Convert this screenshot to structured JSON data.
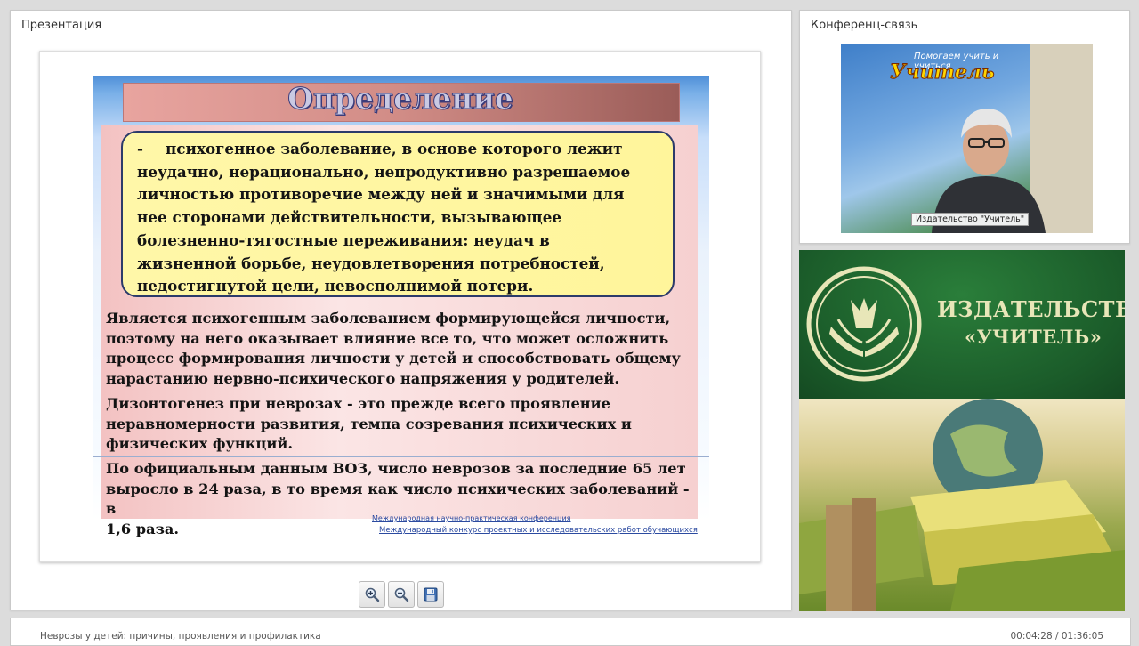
{
  "presentation": {
    "panel_title": "Презентация",
    "slide": {
      "title": "Определение",
      "definition_dash": "-",
      "definition_lines": [
        "психогенное заболевание, в основе которого лежит",
        "неудачно, нерационально, непродуктивно разрешаемое",
        "личностью противоречие между ней и значимыми для",
        "нее сторонами действительности, вызывающее",
        "болезненно-тягостные переживания: неудач в",
        "жизненной борьбе, неудовлетворения потребностей,",
        "недостигнутой цели, невосполнимой потери."
      ],
      "paragraphs": [
        [
          "Является психогенным заболеванием формирующейся личности,",
          "поэтому на него оказывает влияние все то, что может осложнить",
          "процесс формирования личности у детей и способствовать общему",
          "нарастанию нервно-психического напряжения у родителей."
        ],
        [
          "Дизонтогенез при неврозах - это прежде всего проявление",
          "неравномерности развития, темпа созревания психических и",
          "физических функций."
        ],
        [
          "По официальным данным ВОЗ, число неврозов за последние 65 лет",
          "выросло в 24 раза, в то время как число психических заболеваний - в",
          "1,6 раза."
        ]
      ],
      "footer_link_1": "Международная научно-практическая конференция",
      "footer_link_2": "Международный конкурс проектных и исследовательских работ обучающихся"
    },
    "toolbar": {
      "zoom_in_icon": "zoom-in-icon",
      "zoom_out_icon": "zoom-out-icon",
      "save_icon": "save-icon"
    }
  },
  "conference": {
    "panel_title": "Конференц-связь",
    "video_banner_small": "Помогаем учить и учиться",
    "video_banner_big": "Учитель",
    "video_caption": "Издательство \"Учитель\""
  },
  "publisher_banner": {
    "name_line_1": "ИЗДАТЕЛЬСТВО",
    "name_line_2": "«УЧИТЕЛЬ»"
  },
  "status": {
    "lecture_title": "Неврозы у детей: причины, проявления и профилактика",
    "time": "00:04:28 / 01:36:05"
  },
  "colors": {
    "definition_box": "#fff59b",
    "publisher_green": "#1b5c2a"
  }
}
